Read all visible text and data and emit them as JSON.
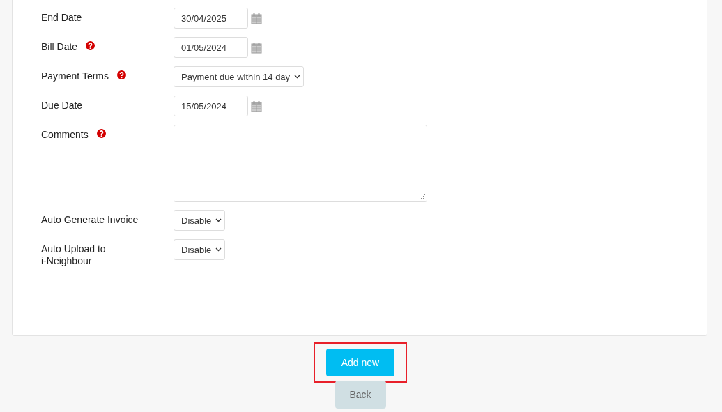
{
  "form": {
    "fields": [
      {
        "label": "End Date",
        "help": false,
        "kind": "date",
        "value": "30/04/2025"
      },
      {
        "label": "Bill Date",
        "help": true,
        "kind": "date",
        "value": "01/05/2024"
      },
      {
        "label": "Payment Terms",
        "help": true,
        "kind": "select",
        "value": "Payment due within 14 day"
      },
      {
        "label": "Due Date",
        "help": false,
        "kind": "date",
        "value": "15/05/2024"
      },
      {
        "label": "Comments",
        "help": true,
        "kind": "textarea"
      },
      {
        "label": "Auto Generate Invoice",
        "help": false,
        "kind": "select",
        "value": "Disable"
      },
      {
        "label": "Auto Upload to\ni-Neighbour",
        "help": false,
        "kind": "select",
        "value": "Disable"
      }
    ]
  },
  "buttons": [
    {
      "label": "Add new",
      "kind": "primary",
      "highlighted": true
    },
    {
      "label": "Back",
      "kind": "secondary",
      "highlighted": false
    }
  ]
}
